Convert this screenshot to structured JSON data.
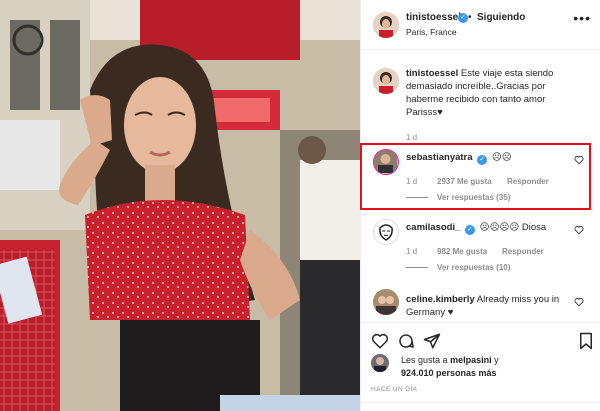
{
  "post": {
    "username": "tinistoessel",
    "follow_dot": "•",
    "follow_label": "Siguiendo",
    "location": "Paris, France",
    "more_label": "•••"
  },
  "caption": {
    "username": "tinistoessel",
    "text": "Este viaje esta siendo demasiado increíble..Gracias por haberme recibido con tanto amor Parisss♥",
    "time": "1 d"
  },
  "comments": [
    {
      "username": "sebastianyatra",
      "text": "☹☹",
      "time": "1 d",
      "likes": "2937 Me gusta",
      "reply_label": "Responder",
      "replies": "Ver respuestas (35)"
    },
    {
      "username": "camilasodi_",
      "text": "☹☹☹☹ Diosa",
      "time": "1 d",
      "likes": "982 Me gusta",
      "reply_label": "Responder",
      "replies": "Ver respuestas (10)"
    },
    {
      "username": "celine.kimberly",
      "text": "Already miss you in Germany ♥",
      "time": ""
    }
  ],
  "likes": {
    "prefix": "Les gusta a",
    "user": "melpasini",
    "conj": "y",
    "count": "924.010 personas más"
  },
  "time_ago": "HACE UN DÍA",
  "icons": {
    "like": "heart-icon",
    "comment": "comment-icon",
    "share": "share-icon",
    "save": "bookmark-icon",
    "verified": "verified-badge-icon"
  },
  "colors": {
    "verified": "#3897f0",
    "highlight": "#e0101f",
    "muted": "#8e8e8e",
    "text": "#262626"
  }
}
